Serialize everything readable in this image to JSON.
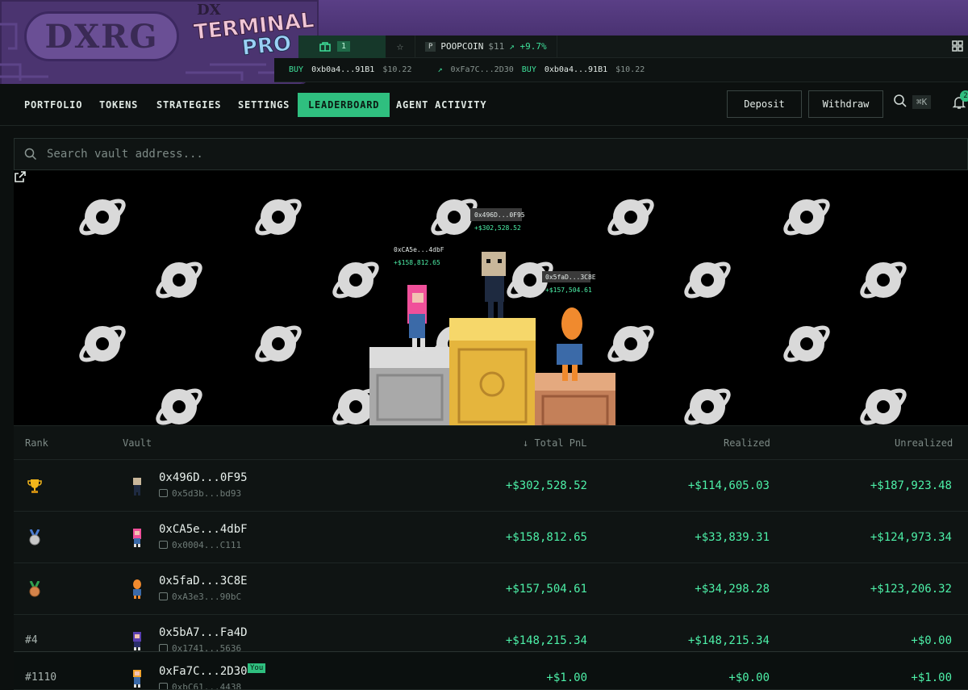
{
  "brand": {
    "logo_text": "DXRG",
    "terminal_line1": "DX",
    "terminal_line2": "TERMINAL",
    "terminal_line3": "PRO"
  },
  "tabs": {
    "stack_count": "1",
    "coin_badge": "P",
    "coin_name": "POOPCOIN",
    "coin_price": "$11",
    "coin_change": "+9.7%"
  },
  "feed": [
    {
      "side": "BUY",
      "addr": "0xb0a4...91B1",
      "amount": "$10.22"
    },
    {
      "from": "0xFa7C...2D30",
      "side": "BUY",
      "addr": "0xb0a4...91B1",
      "amount": "$10.22"
    }
  ],
  "nav": {
    "items": [
      "PORTFOLIO",
      "TOKENS",
      "STRATEGIES",
      "SETTINGS",
      "LEADERBOARD",
      "AGENT ACTIVITY"
    ],
    "active": "LEADERBOARD",
    "deposit": "Deposit",
    "withdraw": "Withdraw",
    "shortcut": "⌘K",
    "notifications": "2"
  },
  "search": {
    "placeholder": "Search vault address..."
  },
  "podium": {
    "first": {
      "addr": "0x496D...0F95",
      "pnl": "+$302,528.52"
    },
    "second": {
      "addr": "0xCA5e...4dbF",
      "pnl": "+$158,812.65"
    },
    "third": {
      "addr": "0x5faD...3C8E",
      "pnl": "+$157,504.61"
    }
  },
  "table": {
    "headers": {
      "rank": "Rank",
      "vault": "Vault",
      "total": "↓ Total PnL",
      "realized": "Realized",
      "unrealized": "Unrealized"
    },
    "rows": [
      {
        "rank": "",
        "vault": "0x496D...0F95",
        "sub": "0x5d3b...bd93",
        "total": "+$302,528.52",
        "realized": "+$114,605.03",
        "unrealized": "+$187,923.48"
      },
      {
        "rank": "",
        "vault": "0xCA5e...4dbF",
        "sub": "0x0004...C111",
        "total": "+$158,812.65",
        "realized": "+$33,839.31",
        "unrealized": "+$124,973.34"
      },
      {
        "rank": "",
        "vault": "0x5faD...3C8E",
        "sub": "0xA3e3...90bC",
        "total": "+$157,504.61",
        "realized": "+$34,298.28",
        "unrealized": "+$123,206.32"
      },
      {
        "rank": "#4",
        "vault": "0x5bA7...Fa4D",
        "sub": "0x1741...5636",
        "total": "+$148,215.34",
        "realized": "+$148,215.34",
        "unrealized": "+$0.00"
      }
    ],
    "you_row": {
      "rank": "#1110",
      "vault": "0xFa7C...2D30",
      "badge": "You",
      "sub": "0xbC61...4438",
      "total": "+$1.00",
      "realized": "+$0.00",
      "unrealized": "+$1.00"
    }
  },
  "colors": {
    "accent": "#2fbf7f",
    "positive": "#4df0a8",
    "banner": "#4b3470",
    "background": "#0c100f"
  }
}
